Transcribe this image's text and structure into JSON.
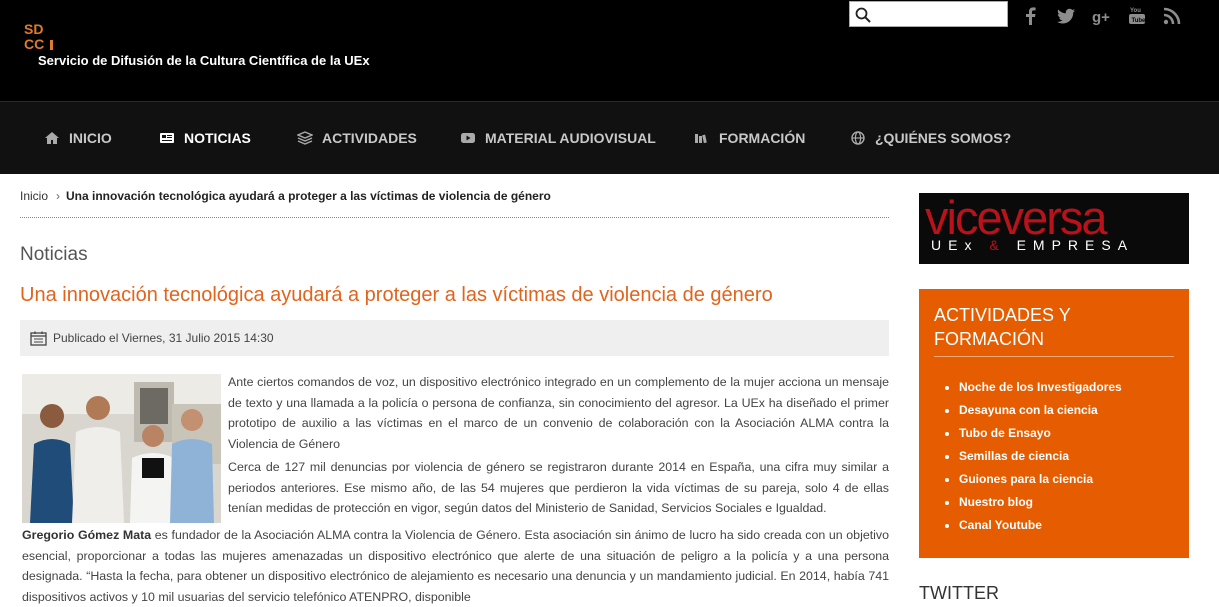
{
  "header": {
    "site_title": "Servicio de Difusión de la Cultura Científica de la UEx",
    "logo_text": "SDCC",
    "search": {
      "value": "",
      "placeholder": ""
    },
    "social": [
      "facebook-icon",
      "twitter-icon",
      "google-plus-icon",
      "youtube-icon",
      "rss-icon"
    ]
  },
  "nav": {
    "items": [
      {
        "label": "INICIO",
        "icon": "home-icon"
      },
      {
        "label": "NOTICIAS",
        "icon": "newspaper-icon",
        "active": true
      },
      {
        "label": "ACTIVIDADES",
        "icon": "layers-icon"
      },
      {
        "label": "MATERIAL AUDIOVISUAL",
        "icon": "video-icon"
      },
      {
        "label": "FORMACIÓN",
        "icon": "books-icon"
      },
      {
        "label": "¿QUIÉNES SOMOS?",
        "icon": "globe-icon"
      }
    ]
  },
  "breadcrumb": {
    "home": "Inicio",
    "current": "Una innovación tecnológica ayudará a proteger a las víctimas de violencia de género"
  },
  "article": {
    "section": "Noticias",
    "title": "Una innovación tecnológica ayudará a proteger a las víctimas de violencia de género",
    "published": "Publicado el Viernes, 31 Julio 2015 14:30",
    "p1": "Ante ciertos comandos de voz, un dispositivo electrónico integrado en un complemento de la mujer acciona un mensaje de texto y una llamada a la policía o persona de confianza, sin conocimiento del agresor. La UEx ha diseñado el primer prototipo de auxilio a las víctimas en el marco de un convenio de colaboración con la Asociación ALMA contra la Violencia de Género",
    "p2": "Cerca de 127 mil denuncias por violencia de género se registraron durante 2014 en España, una cifra muy similar a periodos anteriores. Ese mismo año, de las 54 mujeres que perdieron la vida víctimas de su pareja, solo 4 de ellas tenían medidas de protección en vigor, según datos del Ministerio de Sanidad, Servicios Sociales e Igualdad.",
    "p3_name": "Gregorio Gómez Mata",
    "p3": " es fundador de la Asociación ALMA contra la Violencia de Género. Esta asociación sin ánimo de lucro ha sido creada con un objetivo esencial, proporcionar a todas las mujeres amenazadas un dispositivo electrónico que alerte de una situación de peligro a la policía y a una persona designada. “Hasta la fecha, para obtener un dispositivo electrónico de alejamiento es necesario una denuncia y un mandamiento judicial. En 2014, había 741 dispositivos activos y 10 mil usuarias del servicio telefónico ATENPRO, disponible"
  },
  "sidebar": {
    "banner_word": "viceversa",
    "banner_sub_left": "UEx",
    "banner_amp": "&",
    "banner_sub_right": "EMPRESA",
    "box_title": "ACTIVIDADES Y FORMACIÓN",
    "links": [
      "Noche de los Investigadores",
      "Desayuna con la ciencia",
      "Tubo de Ensayo",
      "Semillas de ciencia",
      "Guiones para la ciencia",
      "Nuestro blog",
      "Canal Youtube"
    ],
    "twitter_heading": "TWITTER"
  },
  "colors": {
    "accent": "#e65c00",
    "title": "#e2631c",
    "nav_bg": "#111111"
  }
}
